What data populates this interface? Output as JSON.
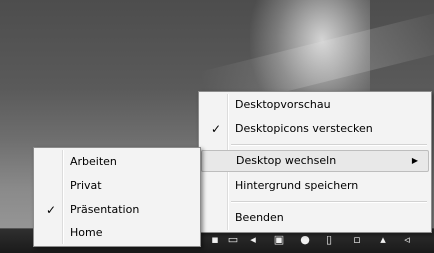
{
  "context_menu": {
    "items": [
      {
        "label": "Desktopvorschau",
        "checked": false
      },
      {
        "label": "Desktopicons verstecken",
        "checked": true
      },
      {
        "label": "Desktop wechseln",
        "has_submenu": true
      },
      {
        "label": "Hintergrund speichern"
      },
      {
        "label": "Beenden"
      }
    ],
    "submenu_arrow_icon": "triangle-right-icon"
  },
  "submenu": {
    "items": [
      {
        "label": "Arbeiten",
        "checked": false
      },
      {
        "label": "Privat",
        "checked": false
      },
      {
        "label": "Präsentation",
        "checked": true
      },
      {
        "label": "Home",
        "checked": false
      }
    ]
  },
  "check_glyph": "✓",
  "taskbar": {
    "tray_icons": [
      "network-icon",
      "display-icon",
      "volume-icon",
      "monitor-icon",
      "shield-icon",
      "flag-icon",
      "device-icon",
      "signal-icon",
      "speaker-icon"
    ]
  }
}
